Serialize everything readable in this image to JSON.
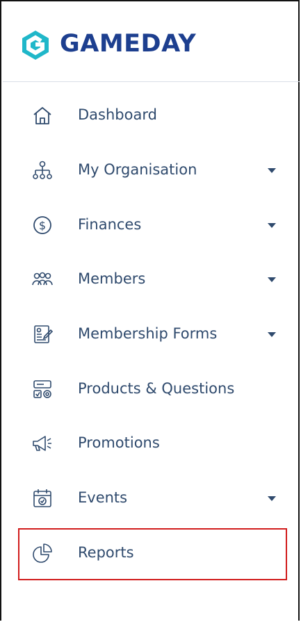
{
  "brand": {
    "name": "GAMEDAY",
    "mark_color": "#20b7c9",
    "text_color": "#1d3f8f"
  },
  "menu": {
    "items": [
      {
        "id": "dashboard",
        "label": "Dashboard",
        "icon": "home-icon",
        "has_dropdown": false
      },
      {
        "id": "my-organisation",
        "label": "My Organisation",
        "icon": "org-chart-icon",
        "has_dropdown": true
      },
      {
        "id": "finances",
        "label": "Finances",
        "icon": "dollar-circle-icon",
        "has_dropdown": true
      },
      {
        "id": "members",
        "label": "Members",
        "icon": "people-icon",
        "has_dropdown": true
      },
      {
        "id": "membership-forms",
        "label": "Membership Forms",
        "icon": "form-icon",
        "has_dropdown": true
      },
      {
        "id": "products-questions",
        "label": "Products & Questions",
        "icon": "products-icon",
        "has_dropdown": false
      },
      {
        "id": "promotions",
        "label": "Promotions",
        "icon": "megaphone-icon",
        "has_dropdown": false
      },
      {
        "id": "events",
        "label": "Events",
        "icon": "calendar-icon",
        "has_dropdown": true
      },
      {
        "id": "reports",
        "label": "Reports",
        "icon": "pie-chart-icon",
        "has_dropdown": false,
        "highlighted": true
      }
    ]
  },
  "colors": {
    "text": "#2f4a6d",
    "highlight_border": "#d11b1b"
  }
}
